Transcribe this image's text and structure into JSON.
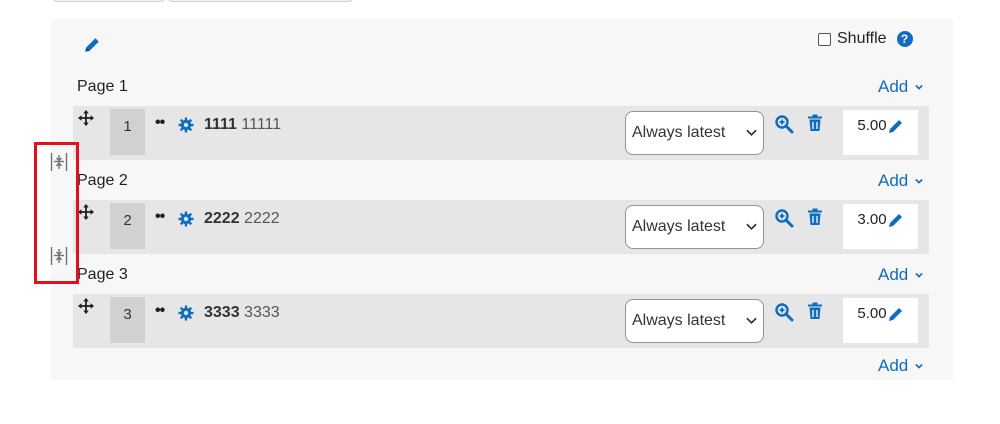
{
  "shuffle": {
    "label": "Shuffle",
    "checked": false,
    "help_icon": "question-circle-icon"
  },
  "add_label": "Add",
  "pages": [
    {
      "label": "Page 1"
    },
    {
      "label": "Page 2"
    },
    {
      "label": "Page 3"
    }
  ],
  "slots": [
    {
      "number": "1",
      "name": "1111",
      "text": "11111",
      "version": "Always latest",
      "mark": "5.00"
    },
    {
      "number": "2",
      "name": "2222",
      "text": "2222",
      "version": "Always latest",
      "mark": "3.00"
    },
    {
      "number": "3",
      "name": "3333",
      "text": "3333",
      "version": "Always latest",
      "mark": "5.00"
    }
  ],
  "colors": {
    "accent": "#0f6cbf",
    "highlight": "#e0101c",
    "slot_bg": "#e6e6e6"
  },
  "icons": {
    "edit": "pencil-icon",
    "move": "move-arrows-icon",
    "settings": "gear-icon",
    "preview": "zoom-in-icon",
    "delete": "trash-icon",
    "page_break": "page-break-icon"
  }
}
